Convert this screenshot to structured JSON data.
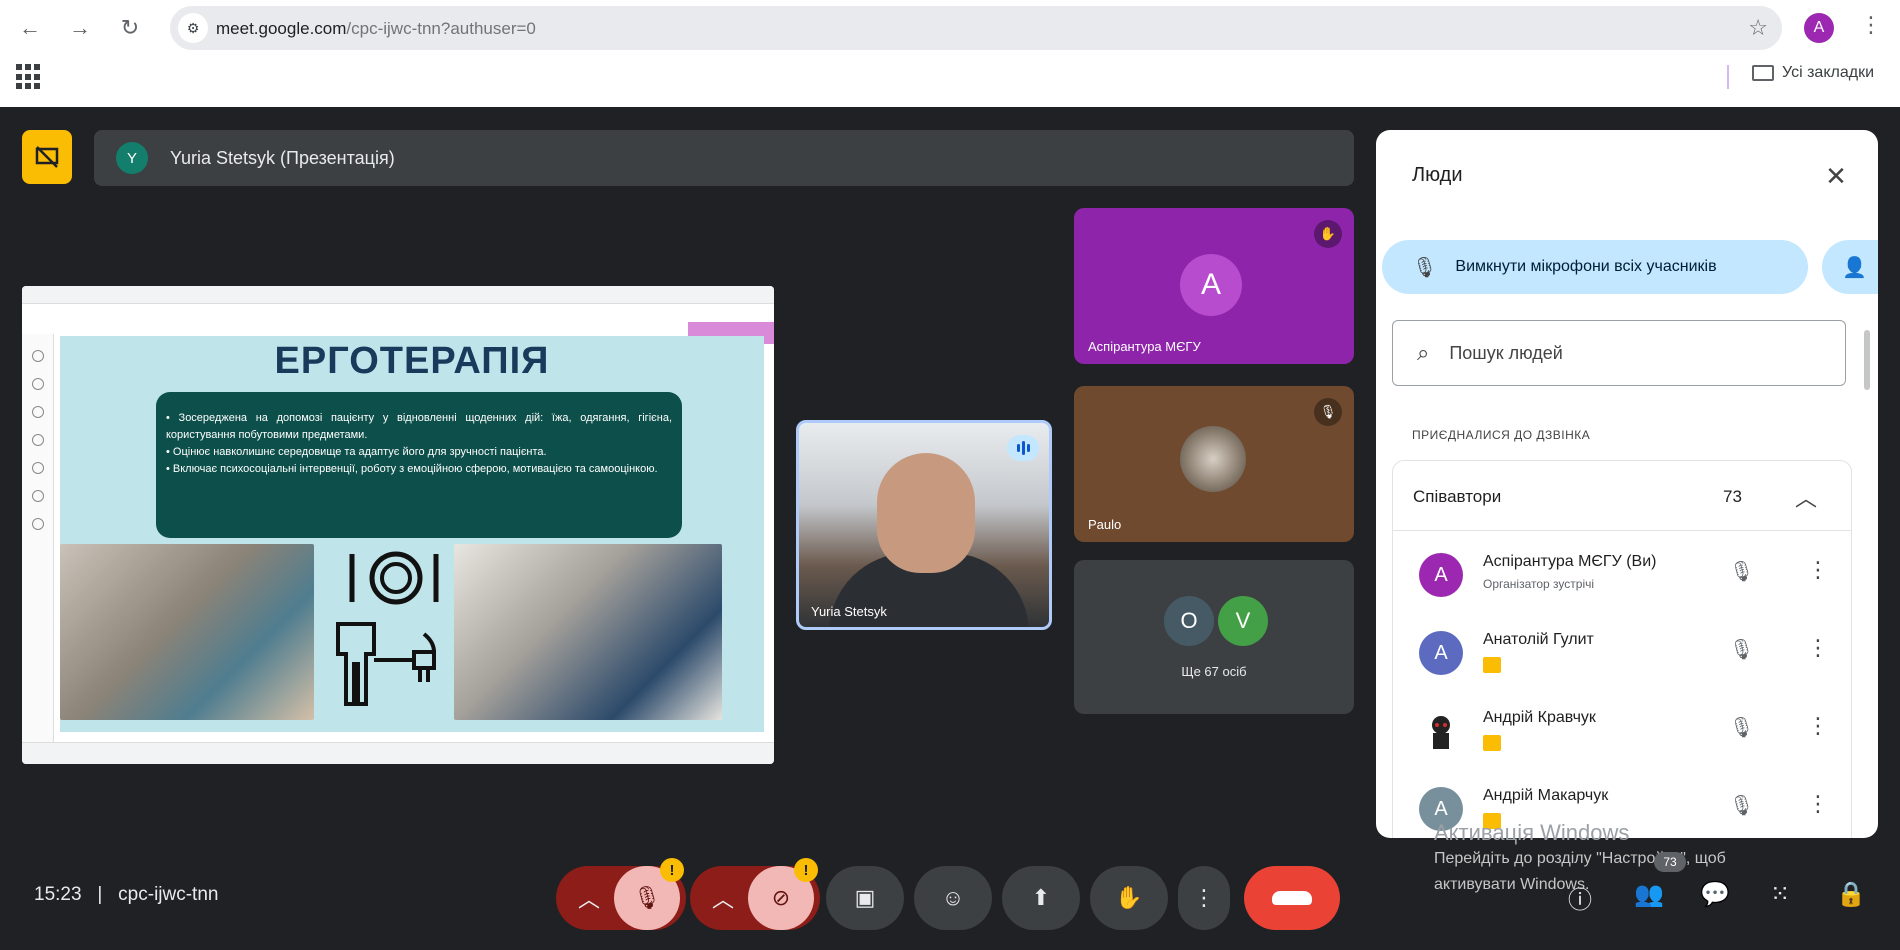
{
  "browser": {
    "url_host": "meet.google.com",
    "url_path": "/cpc-ijwc-tnn?authuser=0",
    "profile_letter": "A",
    "bookmarks_label": "Усі закладки"
  },
  "meet": {
    "presenter_avatar": "Y",
    "presenter_title": "Yuria Stetsyk (Презентація)",
    "clock": "15:23",
    "meeting_code": "cpc-ijwc-tnn"
  },
  "slide": {
    "heading": "ЕРГОТЕРАПІЯ",
    "bullets": [
      "• Зосереджена на допомозі пацієнту у відновленні щоденних дій: їжа, одягання, гігієна, користування побутовими предметами.",
      "• Оцінює навколишнє середовище та адаптує його для зручності пацієнта.",
      "• Включає психосоціальні інтервенції, роботу з емоційною сферою, мотивацією та самооцінкою."
    ]
  },
  "tiles": {
    "speaker_name": "Yuria Stetsyk",
    "tile1_letter": "A",
    "tile1_name": "Аспірантура МЄГУ",
    "tile2_name": "Paulo",
    "tile3_letters": [
      "O",
      "V"
    ],
    "tile3_more": "Ще 67 осіб"
  },
  "people": {
    "title": "Люди",
    "mute_all": "Вимкнути мікрофони всіх учасників",
    "search_placeholder": "Пошук людей",
    "section": "ПРИЄДНАЛИСЯ ДО ДЗВІНКА",
    "group_title": "Співавтори",
    "group_count": "73",
    "list": [
      {
        "letter": "A",
        "name": "Аспірантура МЄГУ (Ви)",
        "sub": "Організатор зустрічі",
        "color": "#9c27b0"
      },
      {
        "letter": "A",
        "name": "Анатолій Гулит",
        "sub": "",
        "color": "#5c6bc0"
      },
      {
        "letter": "",
        "name": "Андрій Кравчук",
        "sub": "",
        "color": "#ffffff"
      },
      {
        "letter": "A",
        "name": "Андрій Макарчук",
        "sub": "",
        "color": "#78909c"
      }
    ]
  },
  "windows": {
    "line1": "Активація Windows",
    "line2": "Перейдіть до розділу \"Настройки\", щоб",
    "line3": "активувати Windows.",
    "badge": "73"
  },
  "colors": {
    "accent": "#fbbc04",
    "hangup": "#ea4335",
    "panel_chip": "#c2e7ff"
  }
}
